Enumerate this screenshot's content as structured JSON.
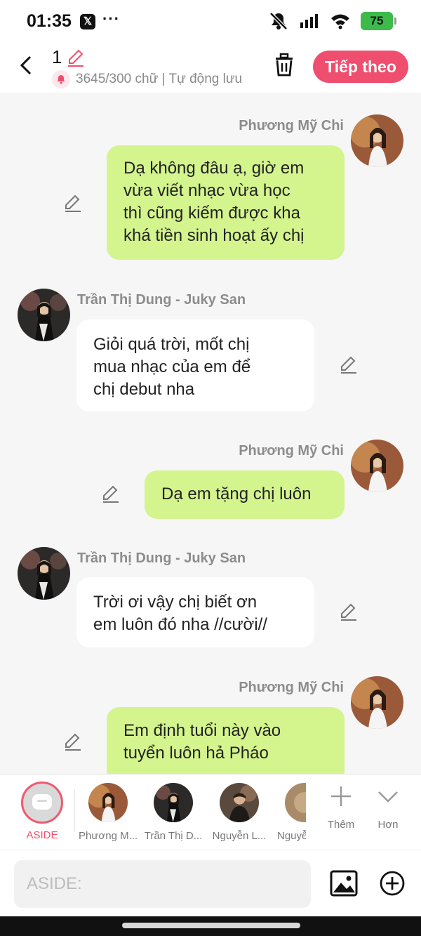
{
  "status_bar": {
    "time": "01:35",
    "x_icon_label": "𝕏",
    "dots": "···",
    "battery": "75"
  },
  "header": {
    "title": "1",
    "stats": "3645/300 chữ | Tự động lưu",
    "next_label": "Tiếp theo",
    "accent": "#ef4e6e"
  },
  "messages": [
    {
      "side": "right",
      "name": "Phương Mỹ Chi",
      "lines": [
        "Dạ không đâu ạ, giờ em",
        "vừa viết nhạc vừa học",
        "thì cũng kiếm được kha",
        "khá tiền sinh hoạt ấy chị"
      ]
    },
    {
      "side": "left",
      "name": "Trần Thị Dung - Juky San",
      "lines": [
        "Giỏi quá trời, mốt chị",
        "mua nhạc của em để",
        "chị debut nha"
      ]
    },
    {
      "side": "right",
      "name": "Phương Mỹ Chi",
      "lines": [
        "Dạ em tặng chị luôn"
      ]
    },
    {
      "side": "left",
      "name": "Trần Thị Dung - Juky San",
      "lines": [
        "Trời ơi vậy chị biết ơn",
        "em luôn đó nha //cười//"
      ]
    },
    {
      "side": "right",
      "name": "Phương Mỹ Chi",
      "lines": [
        "Em định tuổi này vào",
        "tuyển luôn hả Pháo"
      ]
    }
  ],
  "characters": {
    "aside_label": "ASIDE",
    "items": [
      {
        "label": "Phương M..."
      },
      {
        "label": "Trần Thị D..."
      },
      {
        "label": "Nguyễn L..."
      },
      {
        "label": "Nguyễ"
      }
    ],
    "more_label": "Thêm",
    "expand_label": "Hơn"
  },
  "input": {
    "placeholder": "ASIDE:"
  },
  "colors": {
    "bubble_green": "#d4f48e",
    "bubble_white": "#ffffff",
    "background": "#f6f6f6"
  }
}
